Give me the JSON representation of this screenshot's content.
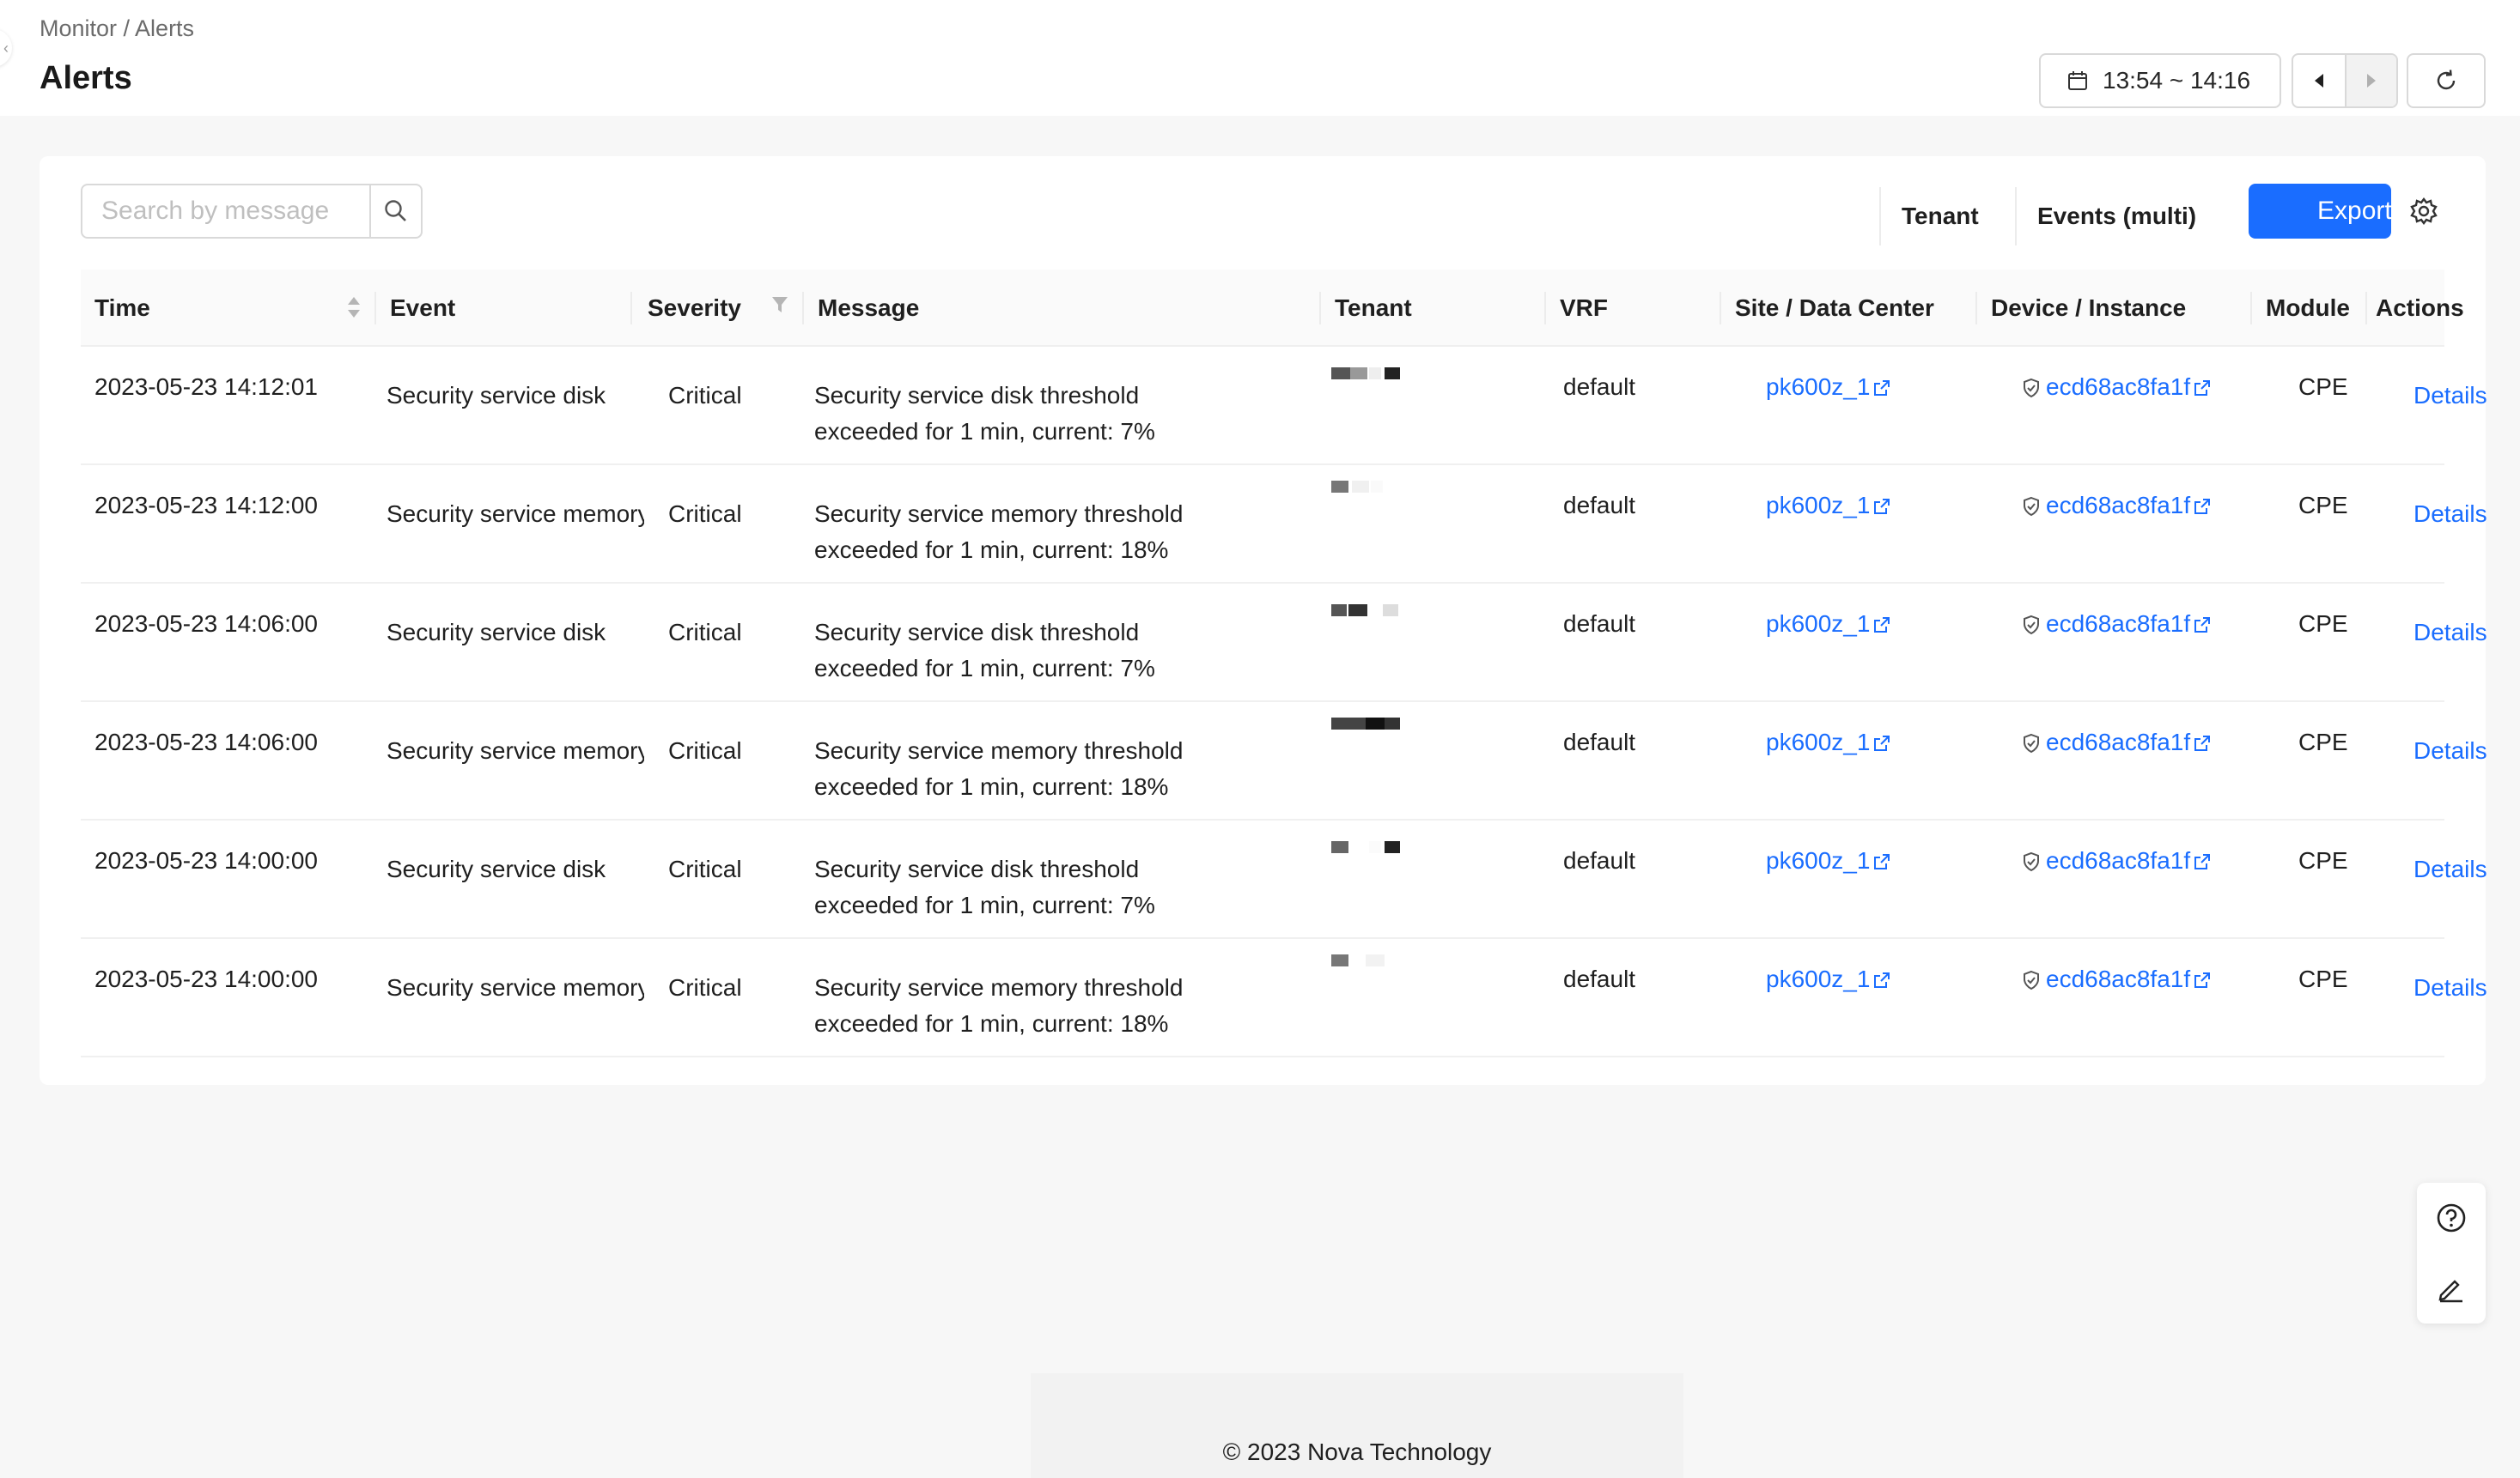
{
  "breadcrumb": "Monitor / Alerts",
  "page_title": "Alerts",
  "time_range": "13:54 ~ 14:16",
  "search": {
    "placeholder": "Search by message"
  },
  "filters": {
    "tenant": "Tenant",
    "events": "Events (multi)"
  },
  "export_label": "Export",
  "columns": {
    "time": "Time",
    "event": "Event",
    "severity": "Severity",
    "message": "Message",
    "tenant": "Tenant",
    "vrf": "VRF",
    "site": "Site / Data Center",
    "device": "Device / Instance",
    "module": "Module",
    "actions": "Actions"
  },
  "rows": [
    {
      "time": "2023-05-23 14:12:01",
      "event": "Security service disk",
      "severity": "Critical",
      "msg1": "Security service disk threshold",
      "msg2": "exceeded for 1 min, current: 7%",
      "vrf": "default",
      "site": "pk600z_1",
      "device": "ecd68ac8fa1f",
      "module": "CPE",
      "action": "Details"
    },
    {
      "time": "2023-05-23 14:12:00",
      "event": "Security service memory",
      "severity": "Critical",
      "msg1": "Security service memory threshold",
      "msg2": "exceeded for 1 min, current: 18%",
      "vrf": "default",
      "site": "pk600z_1",
      "device": "ecd68ac8fa1f",
      "module": "CPE",
      "action": "Details"
    },
    {
      "time": "2023-05-23 14:06:00",
      "event": "Security service disk",
      "severity": "Critical",
      "msg1": "Security service disk threshold",
      "msg2": "exceeded for 1 min, current: 7%",
      "vrf": "default",
      "site": "pk600z_1",
      "device": "ecd68ac8fa1f",
      "module": "CPE",
      "action": "Details"
    },
    {
      "time": "2023-05-23 14:06:00",
      "event": "Security service memory",
      "severity": "Critical",
      "msg1": "Security service memory threshold",
      "msg2": "exceeded for 1 min, current: 18%",
      "vrf": "default",
      "site": "pk600z_1",
      "device": "ecd68ac8fa1f",
      "module": "CPE",
      "action": "Details"
    },
    {
      "time": "2023-05-23 14:00:00",
      "event": "Security service disk",
      "severity": "Critical",
      "msg1": "Security service disk threshold",
      "msg2": "exceeded for 1 min, current: 7%",
      "vrf": "default",
      "site": "pk600z_1",
      "device": "ecd68ac8fa1f",
      "module": "CPE",
      "action": "Details"
    },
    {
      "time": "2023-05-23 14:00:00",
      "event": "Security service memory",
      "severity": "Critical",
      "msg1": "Security service memory threshold",
      "msg2": "exceeded for 1 min, current: 18%",
      "vrf": "default",
      "site": "pk600z_1",
      "device": "ecd68ac8fa1f",
      "module": "CPE",
      "action": "Details"
    }
  ],
  "footer": "© 2023 Nova Technology",
  "colors": {
    "primary": "#1a6dff",
    "link": "#1a6dff",
    "background": "#f7f7f7"
  },
  "icons": [
    "calendar-icon",
    "caret-left-icon",
    "caret-right-icon",
    "refresh-icon",
    "search-icon",
    "gear-icon",
    "sort-icon",
    "filter-icon",
    "external-link-icon",
    "shield-icon",
    "help-icon",
    "edit-icon"
  ]
}
